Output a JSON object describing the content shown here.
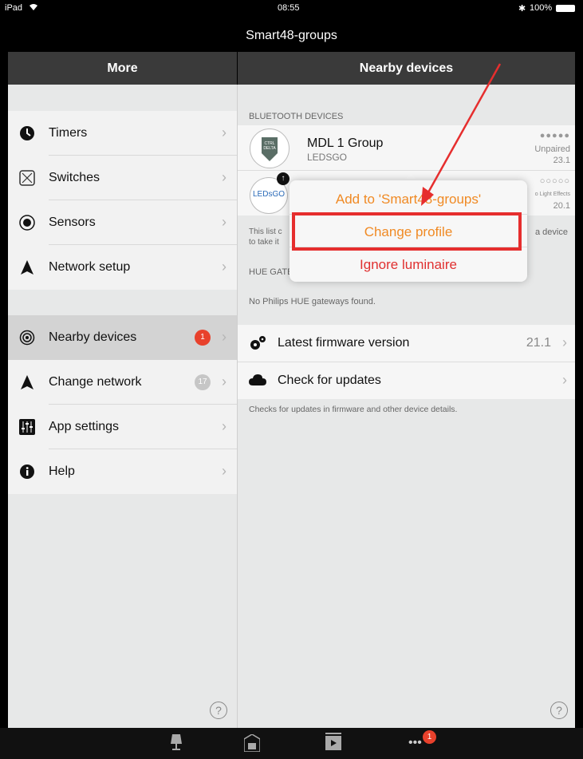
{
  "status_bar": {
    "device": "iPad",
    "time": "08:55",
    "battery": "100%"
  },
  "app_title": "Smart48-groups",
  "left_header": "More",
  "right_header": "Nearby devices",
  "menu_group1": [
    {
      "label": "Timers",
      "icon": "clock-icon"
    },
    {
      "label": "Switches",
      "icon": "switch-icon"
    },
    {
      "label": "Sensors",
      "icon": "sensor-icon"
    },
    {
      "label": "Network setup",
      "icon": "network-icon"
    }
  ],
  "menu_group2": [
    {
      "label": "Nearby devices",
      "icon": "nearby-icon",
      "badge": "1"
    },
    {
      "label": "Change network",
      "icon": "network-icon",
      "badge": "17"
    },
    {
      "label": "App settings",
      "icon": "sliders-icon"
    },
    {
      "label": "Help",
      "icon": "info-icon"
    }
  ],
  "bluetooth": {
    "heading": "BLUETOOTH DEVICES",
    "devices": [
      {
        "name": "MDL 1 Group",
        "vendor": "LEDSGO",
        "logo_text": "CTRL DELTA",
        "status": "Unpaired",
        "version": "23.1",
        "signal": "●●●●●"
      },
      {
        "name": "",
        "vendor": "",
        "logo_text": "LEDsGO",
        "status": "o Light Effects",
        "version": "20.1",
        "signal": "○○○○○"
      }
    ],
    "note_left": "This list c",
    "note_left2": "to take it",
    "note_right": "a device"
  },
  "hue": {
    "heading": "HUE GATE",
    "empty": "No Philips HUE gateways found."
  },
  "firmware": {
    "label": "Latest firmware version",
    "value": "21.1"
  },
  "updates": {
    "label": "Check for updates",
    "note": "Checks for updates in firmware and other device details."
  },
  "popover": {
    "add": "Add to 'Smart48-groups'",
    "change": "Change profile",
    "ignore": "Ignore luminaire"
  },
  "tabbar": {
    "more_badge": "1"
  },
  "colors": {
    "accent_orange": "#f08a24",
    "ignore_red": "#e03030",
    "highlight_red": "#e62e2e",
    "badge_red": "#e8412c"
  }
}
